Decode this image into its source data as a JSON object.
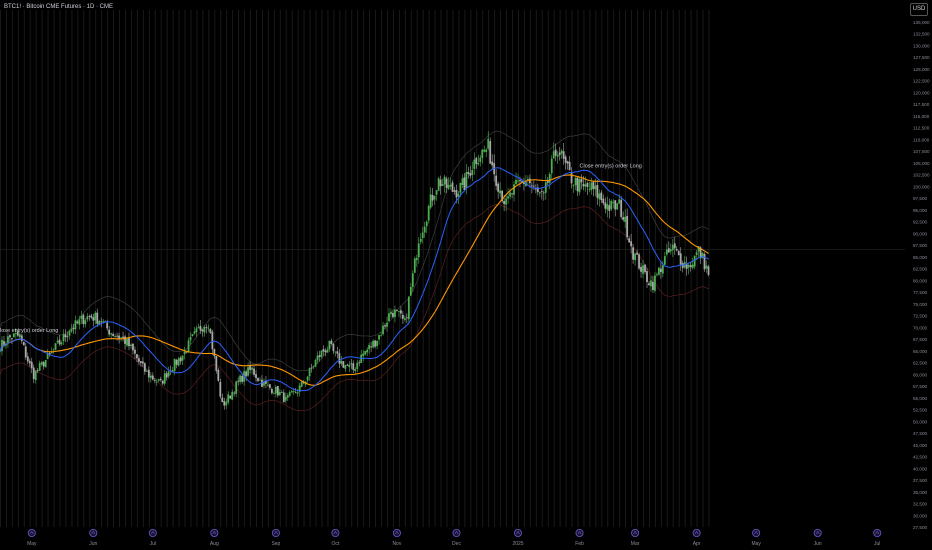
{
  "title": "BTC1! · Bitcoin CME Futures · 1D · CME",
  "currency": "USD",
  "colors": {
    "background": "#000000",
    "bull": "#4caf50",
    "bear": "#a9a9a9",
    "ma_fast": "#2962ff",
    "ma_slow": "#ff9800",
    "bands": "#3a3f3a",
    "band_low_red": "#5a1f1f",
    "vstripe": "#1c1c1c",
    "axis_text": "#8a8e97",
    "event_marker": "#6a5acd"
  },
  "chart_data": {
    "type": "candlestick",
    "ylim": [
      27500,
      137500
    ],
    "y_ticks": [
      27500,
      30000,
      32500,
      35000,
      37500,
      40000,
      42500,
      45000,
      47500,
      50000,
      52500,
      55000,
      57500,
      60000,
      62500,
      65000,
      67500,
      70000,
      72500,
      75000,
      77500,
      80000,
      82500,
      85000,
      87500,
      90000,
      92500,
      95000,
      97500,
      100000,
      102500,
      105000,
      107500,
      110000,
      112500,
      115000,
      117500,
      120000,
      122500,
      125000,
      127500,
      130000,
      132500,
      135000
    ],
    "y_tick_labels": [
      "27,500",
      "30,000",
      "32,500",
      "35,000",
      "37,500",
      "40,000",
      "42,500",
      "45,000",
      "47,500",
      "50,000",
      "52,500",
      "55,000",
      "57,500",
      "60,000",
      "62,500",
      "65,000",
      "67,500",
      "70,000",
      "72,500",
      "75,000",
      "77,500",
      "80,000",
      "82,500",
      "85,000",
      "87,500",
      "90,000",
      "92,500",
      "95,000",
      "97,500",
      "100,000",
      "102,500",
      "105,000",
      "107,500",
      "110,000",
      "112,500",
      "115,000",
      "117,500",
      "120,000",
      "122,500",
      "125,000",
      "127,500",
      "130,000",
      "132,500",
      "135,000"
    ],
    "x_ticks": [
      "May",
      "Jun",
      "Jul",
      "Aug",
      "Sep",
      "Oct",
      "Nov",
      "Dec",
      "2025",
      "Feb",
      "Mar",
      "Apr",
      "May",
      "Jun",
      "Jul"
    ],
    "x_tick_dates": [
      "2024-05-01",
      "2024-06-01",
      "2024-07-01",
      "2024-08-01",
      "2024-09-01",
      "2024-10-01",
      "2024-11-01",
      "2024-12-01",
      "2025-01-01",
      "2025-02-01",
      "2025-03-01",
      "2025-04-01",
      "2025-05-01",
      "2025-06-01",
      "2025-07-01"
    ],
    "xlim": [
      "2024-04-15",
      "2025-07-15"
    ],
    "events": [
      "2024-05-01",
      "2024-06-01",
      "2024-07-01",
      "2024-08-01",
      "2024-09-01",
      "2024-10-01",
      "2024-11-01",
      "2024-12-01",
      "2025-01-01",
      "2025-02-01",
      "2025-03-01",
      "2025-04-01",
      "2025-05-01",
      "2025-06-01",
      "2025-07-01"
    ],
    "price_line": 86500,
    "close_anchors": [
      [
        "2024-04-15",
        66000
      ],
      [
        "2024-04-25",
        68000
      ],
      [
        "2024-05-02",
        60500
      ],
      [
        "2024-05-10",
        63000
      ],
      [
        "2024-05-20",
        70500
      ],
      [
        "2024-06-05",
        72000
      ],
      [
        "2024-06-25",
        62500
      ],
      [
        "2024-07-05",
        57500
      ],
      [
        "2024-07-20",
        67500
      ],
      [
        "2024-07-29",
        70500
      ],
      [
        "2024-08-05",
        54000
      ],
      [
        "2024-08-20",
        61000
      ],
      [
        "2024-09-06",
        54000
      ],
      [
        "2024-09-28",
        66000
      ],
      [
        "2024-10-10",
        60500
      ],
      [
        "2024-10-29",
        73000
      ],
      [
        "2024-11-05",
        70500
      ],
      [
        "2024-11-12",
        90000
      ],
      [
        "2024-11-22",
        100000
      ],
      [
        "2024-12-05",
        100500
      ],
      [
        "2024-12-17",
        109000
      ],
      [
        "2024-12-26",
        95500
      ],
      [
        "2025-01-06",
        102500
      ],
      [
        "2025-01-14",
        97000
      ],
      [
        "2025-01-21",
        107500
      ],
      [
        "2025-02-03",
        99000
      ],
      [
        "2025-02-21",
        96000
      ],
      [
        "2025-02-28",
        85000
      ],
      [
        "2025-03-10",
        80000
      ],
      [
        "2025-03-20",
        86000
      ],
      [
        "2025-03-28",
        84000
      ],
      [
        "2025-04-02",
        86000
      ],
      [
        "2025-04-07",
        80500
      ]
    ],
    "annotations": [
      {
        "date": "2024-04-13",
        "price": 69000,
        "text": "Close entry(s) order Long"
      },
      {
        "date": "2025-02-01",
        "price": 104000,
        "text": "Close entry(s) order Long"
      }
    ],
    "series": [
      {
        "type": "candles"
      },
      {
        "type": "moving_average_fast",
        "period": 20
      },
      {
        "type": "moving_average_slow",
        "period": 50
      },
      {
        "type": "bands"
      }
    ]
  }
}
